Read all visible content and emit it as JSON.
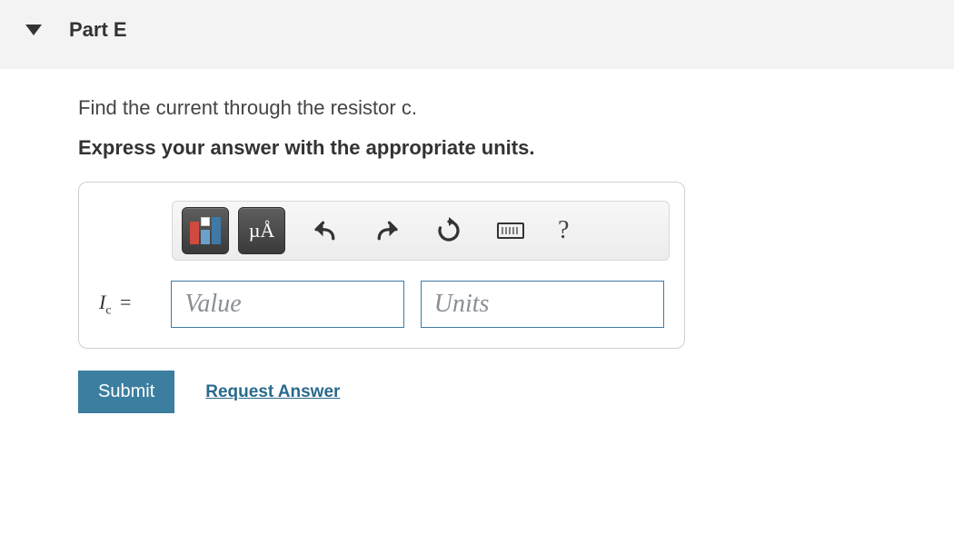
{
  "header": {
    "title": "Part E"
  },
  "prompt": "Find the current through the resistor c.",
  "instruction": "Express your answer with the appropriate units.",
  "toolbar": {
    "templates_icon": "templates-icon",
    "special_chars_label": "µÅ",
    "undo_icon": "undo-icon",
    "redo_icon": "redo-icon",
    "reset_icon": "reset-icon",
    "keyboard_icon": "keyboard-icon",
    "help_label": "?"
  },
  "equation": {
    "symbol": "I",
    "subscript": "c",
    "equals": "="
  },
  "inputs": {
    "value_placeholder": "Value",
    "units_placeholder": "Units",
    "value": "",
    "units": ""
  },
  "actions": {
    "submit_label": "Submit",
    "request_answer_label": "Request Answer"
  }
}
